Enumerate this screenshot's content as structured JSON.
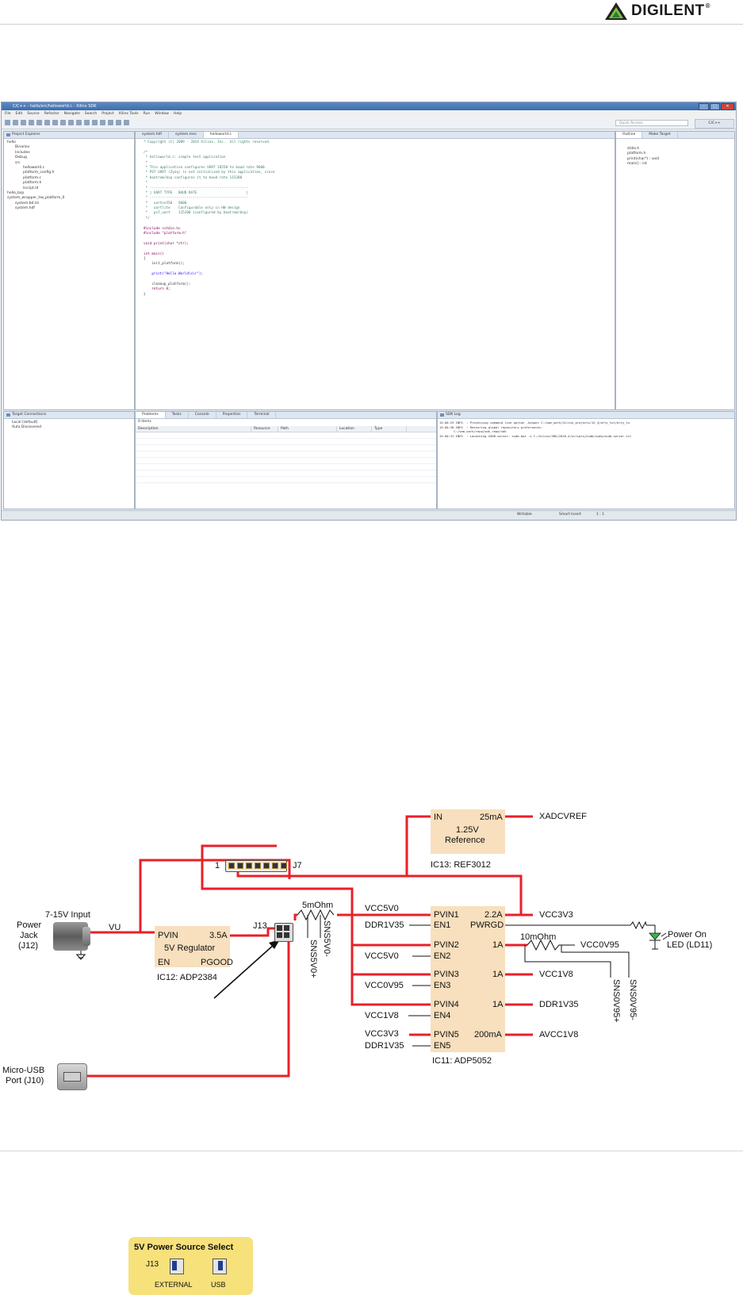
{
  "header": {
    "brand": "DIGILENT",
    "trademark": "®"
  },
  "ide": {
    "window_title": "C/C++ - hello/src/helloworld.c - Xilinx SDK",
    "menu": [
      "File",
      "Edit",
      "Source",
      "Refactor",
      "Navigate",
      "Search",
      "Project",
      "Xilinx Tools",
      "Run",
      "Window",
      "Help"
    ],
    "quick_access": "Quick Access",
    "perspective": "C/C++",
    "project_explorer": {
      "tab": "Project Explorer",
      "items": [
        "hello",
        "Binaries",
        "Includes",
        "Debug",
        "src",
        "helloworld.c",
        "platform_config.h",
        "platform.c",
        "platform.h",
        "lscript.ld",
        "hello_bsp",
        "system_wrapper_hw_platform_0",
        "system.bd.tcl",
        "system.hdf"
      ]
    },
    "editor_tabs": [
      "system.hdf",
      "system.mss",
      "helloworld.c"
    ],
    "code_lines": [
      "* Copyright (C) 2009 - 2014 Xilinx, Inc.  All rights reserved.",
      "",
      "/*",
      " * helloworld.c: simple test application",
      " *",
      " * This application configures UART 16550 to baud rate 9600.",
      " * PS7 UART (Zynq) is not initialized by this application, since",
      " * bootrom/bsp configures it to baud rate 115200",
      " *",
      " * ------------------------------------------------",
      " * | UART TYPE   BAUD RATE                        |",
      " * ------------------------------------------------",
      " *   uartns550   9600",
      " *   uartlite    Configurable only in HW design",
      " *   ps7_uart    115200 (configured by bootrom/bsp)",
      " */",
      "",
      "#include <stdio.h>",
      "#include \"platform.h\"",
      "",
      "void print(char *str);",
      "",
      "int main()",
      "{",
      "    init_platform();",
      "",
      "    print(\"Hello World\\n\\r\");",
      "",
      "    cleanup_platform();",
      "    return 0;",
      "}"
    ],
    "outline": {
      "tabs": [
        "Outline",
        "Make Target"
      ],
      "items": [
        "stdio.h",
        "platform.h",
        "print(char*) : void",
        "main() : int"
      ]
    },
    "target_connections": {
      "tab": "Target Connections",
      "items": [
        "Local [default]",
        "Auto Discovered"
      ]
    },
    "problems": {
      "tabs": [
        "Problems",
        "Tasks",
        "Console",
        "Properties",
        "Terminal"
      ],
      "count": "0 items",
      "columns": [
        "Description",
        "Resource",
        "Path",
        "Location",
        "Type"
      ]
    },
    "sdk_log": {
      "tab": "SDK Log",
      "lines": [
        "15:00:29 INFO  : Processing command line option -hwspec C:/sam_work/Xilinx_projects/15_4/arty_tut/arty_tu",
        "15:00:30 INFO  : Restoring global repository preferences:",
        "        C:/sam_work/repo/sdk_repo/sdk",
        "15:00:31 INFO  : Launching XSDB server: xsdb.bat -s C:/Xilinx/SDK/2016.4/scripts/xsdb/xsdb/xsdb-server.tcl"
      ]
    },
    "status": [
      "Writable",
      "Smart Insert",
      "1 : 1"
    ]
  },
  "schematic": {
    "labels": {
      "input_voltage": "7-15V Input",
      "power_jack": [
        "Power",
        "Jack",
        "(J12)"
      ],
      "vu": "VU",
      "reg_pvin": "PVIN",
      "reg_current": "3.5A",
      "reg_name": "5V Regulator",
      "reg_en": "EN",
      "reg_pgood": "PGOOD",
      "reg_part": "IC12: ADP2384",
      "j7_pin": "1",
      "j7": "J7",
      "j13": "J13",
      "sense_res": "5mOhm",
      "sns5v0_plus": "SNS5V0+",
      "sns5v0_minus": "SNS5V0-",
      "ref_in": "IN",
      "ref_current": "25mA",
      "ref_name": [
        "1.25V",
        "Reference"
      ],
      "ref_part": "IC13: REF3012",
      "xadcvref": "XADCVREF",
      "vcc5v0_a": "VCC5V0",
      "ddr1v35_a": "DDR1V35",
      "vcc5v0_b": "VCC5V0",
      "vcc0v95_a": "VCC0V95",
      "vcc1v8_a": "VCC1V8",
      "vcc3v3_a": "VCC3V3",
      "ddr1v35_b": "DDR1V35",
      "pmic_pins": [
        "PVIN1",
        "EN1",
        "PVIN2",
        "EN2",
        "PVIN3",
        "EN3",
        "PVIN4",
        "EN4",
        "PVIN5",
        "EN5"
      ],
      "pmic_right": [
        "2.2A",
        "PWRGD",
        "1A",
        "1A",
        "1A",
        "200mA"
      ],
      "pmic_part": "IC11: ADP5052",
      "vcc3v3_out": "VCC3V3",
      "sense_res2": "10mOhm",
      "vcc0v95_out": "VCC0V95",
      "vcc1v8_out": "VCC1V8",
      "ddr1v35_out": "DDR1V35",
      "avcc1v8_out": "AVCC1V8",
      "sns0v95_plus": "SNS0V95+",
      "sns0v95_minus": "SNS0V95-",
      "led": [
        "Power On",
        "LED (LD11)"
      ],
      "usb": [
        "Micro-USB",
        "Port (J10)"
      ],
      "psel_title": "5V Power Source Select",
      "psel_j13": "J13",
      "psel_external": "EXTERNAL",
      "psel_usb": "USB"
    },
    "colors": {
      "wire": "#e8202a",
      "chip": "#f8dfbd",
      "selector": "#f6e17b",
      "led": "#39b54a"
    }
  }
}
